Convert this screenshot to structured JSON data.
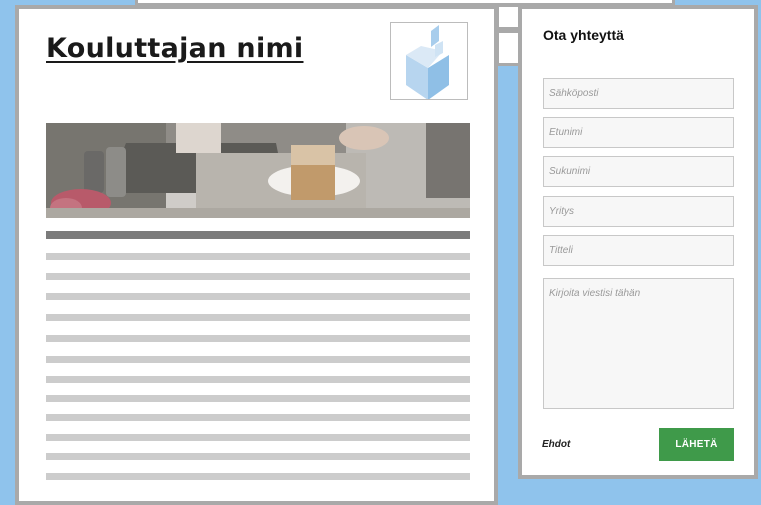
{
  "trainer": {
    "name": "Kouluttajan nimi",
    "logo_icon": "cube-logo-icon",
    "image": "coffee-table-photo"
  },
  "contact": {
    "title": "Ota yhteyttä",
    "fields": {
      "email_placeholder": "Sähköposti",
      "firstname_placeholder": "Etunimi",
      "lastname_placeholder": "Sukunimi",
      "company_placeholder": "Yritys",
      "jobtitle_placeholder": "Titteli",
      "message_placeholder": "Kirjoita viestisi tähän"
    },
    "terms_label": "Ehdot",
    "send_label": "LÄHETÄ"
  },
  "colors": {
    "background": "#8fc3ec",
    "card_border": "#a9a9a9",
    "send_button": "#3f9a4a",
    "logo_blue": "#a8cdec"
  }
}
